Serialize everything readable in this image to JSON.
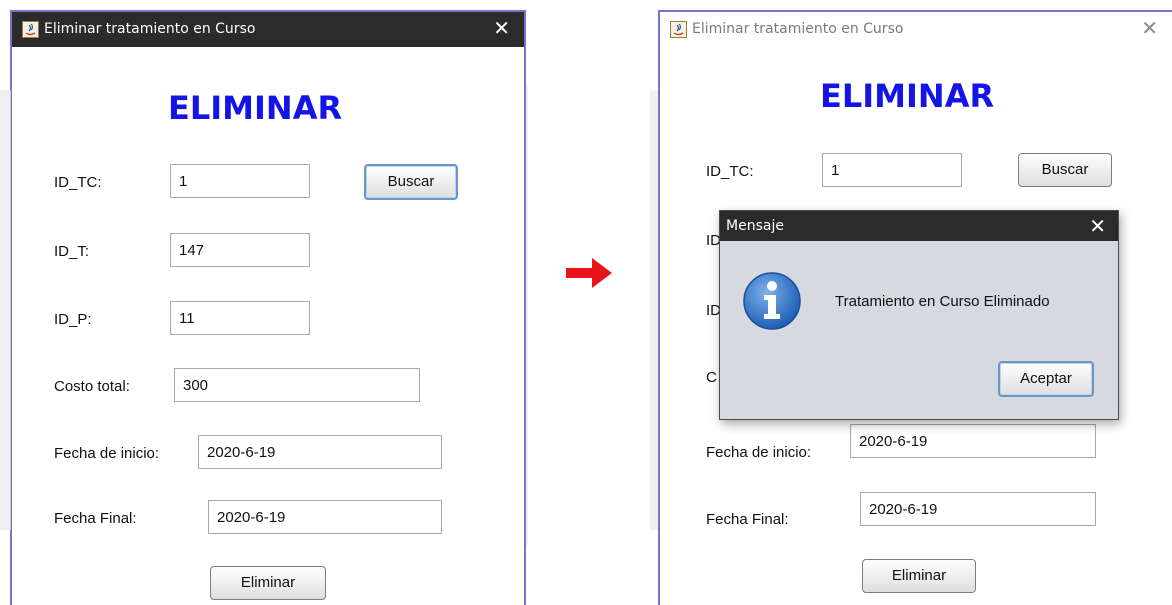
{
  "left_window": {
    "title": "Eliminar tratamiento en Curso",
    "close_glyph": "✕",
    "heading": "ELIMINAR",
    "fields": {
      "id_tc_label": "ID_TC:",
      "id_tc_value": "1",
      "id_t_label": "ID_T:",
      "id_t_value": "147",
      "id_p_label": "ID_P:",
      "id_p_value": "11",
      "costo_label": "Costo total:",
      "costo_value": "300",
      "fecha_inicio_label": "Fecha de inicio:",
      "fecha_inicio_value": "2020-6-19",
      "fecha_final_label": "Fecha Final:",
      "fecha_final_value": "2020-6-19"
    },
    "buscar_label": "Buscar",
    "eliminar_label": "Eliminar"
  },
  "right_window": {
    "title": "Eliminar tratamiento en Curso",
    "close_glyph": "✕",
    "heading": "ELIMINAR",
    "fields": {
      "id_tc_label": "ID_TC:",
      "id_tc_value": "1",
      "id_t_label_partial": "ID",
      "id_p_label_partial": "ID",
      "costo_label_partial": "C",
      "fecha_inicio_label": "Fecha de inicio:",
      "fecha_inicio_value": "2020-6-19",
      "fecha_final_label": "Fecha Final:",
      "fecha_final_value": "2020-6-19"
    },
    "buscar_label": "Buscar",
    "eliminar_label": "Eliminar"
  },
  "dialog": {
    "title": "Mensaje",
    "close_glyph": "✕",
    "message": "Tratamiento en Curso Eliminado",
    "accept_label": "Aceptar",
    "icon": "info-icon"
  },
  "arrow": {
    "icon": "right-arrow-icon",
    "color": "#e8141a"
  },
  "colors": {
    "heading": "#1414e6",
    "window_border": "#7a74c8",
    "titlebar_dark": "#2b2b2b"
  }
}
